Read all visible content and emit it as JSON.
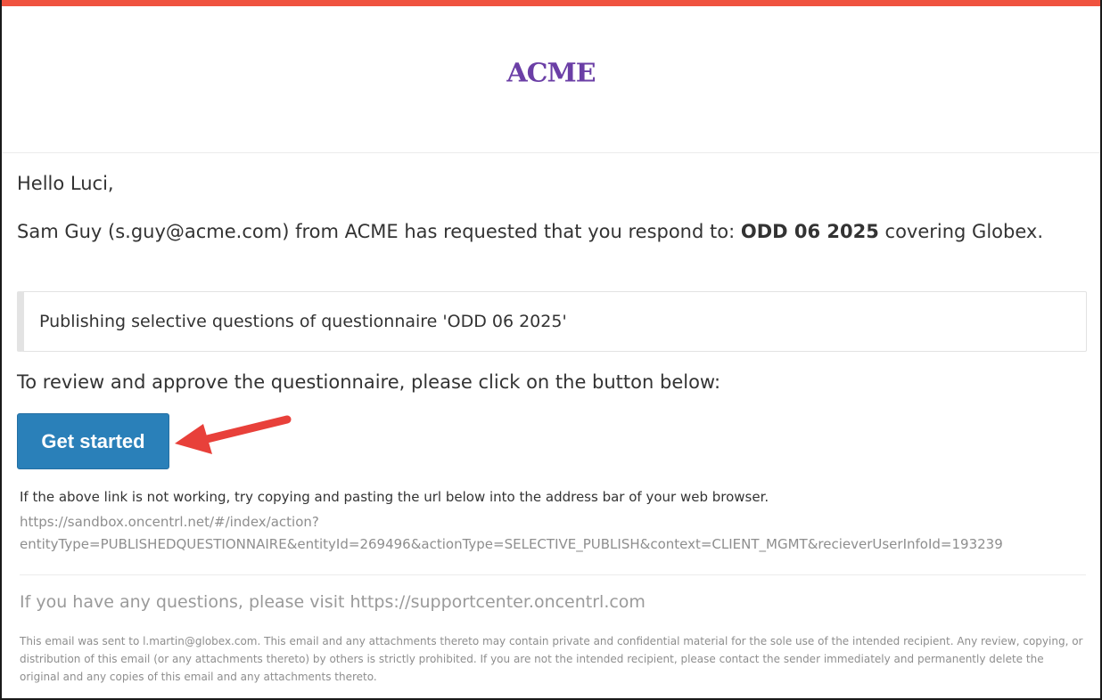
{
  "brand": {
    "logo_text": "ACME",
    "logo_color": "#6b3fa6",
    "accent_bar_color": "#f0533f"
  },
  "email": {
    "greeting": "Hello Luci,",
    "request_prefix": "Sam Guy (s.guy@acme.com) from ACME has requested that you respond to: ",
    "request_bold": "ODD 06 2025",
    "request_suffix": " covering Globex.",
    "message": "Publishing selective questions of questionnaire 'ODD 06 2025'",
    "instruction": "To review and approve the questionnaire, please click on the button below:",
    "button_label": "Get started",
    "button_color": "#2a80b9",
    "fallback_text": "If the above link is not working, try copying and pasting the url below into the address bar of your web browser.",
    "fallback_url_line1": "https://sandbox.oncentrl.net/#/index/action?",
    "fallback_url_line2": "entityType=PUBLISHEDQUESTIONNAIRE&entityId=269496&actionType=SELECTIVE_PUBLISH&context=CLIENT_MGMT&recieverUserInfoId=193239",
    "support_text": "If you have any questions, please visit https://supportcenter.oncentrl.com",
    "disclaimer": "This email was sent to l.martin@globex.com. This email and any attachments thereto may contain private and confidential material for the sole use of the intended recipient. Any review, copying, or distribution of this email (or any attachments thereto) by others is strictly prohibited. If you are not the intended recipient, please contact the sender immediately and permanently delete the original and any copies of this email and any attachments thereto."
  },
  "annotation": {
    "arrow_icon": "red-arrow-icon",
    "arrow_color": "#e8403a"
  }
}
